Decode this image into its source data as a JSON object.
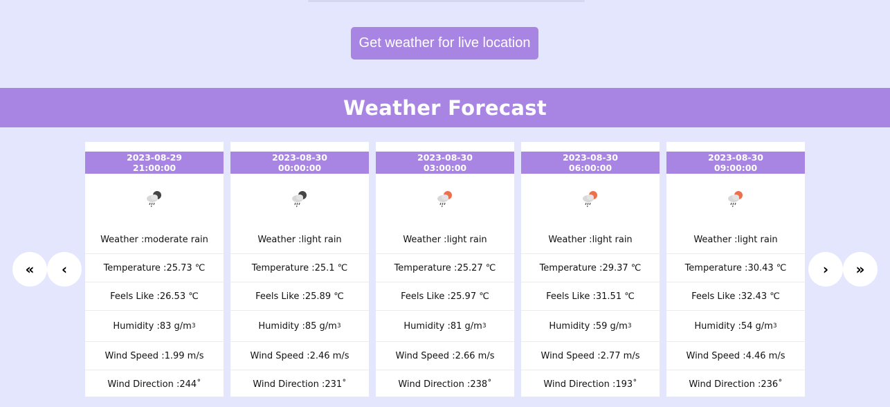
{
  "live_button": {
    "label": "Get weather for live location"
  },
  "banner": {
    "title": "Weather Forecast"
  },
  "nav": {
    "first_icon": "double-chevron-left-icon",
    "prev_icon": "chevron-left-icon",
    "next_icon": "chevron-right-icon",
    "last_icon": "double-chevron-right-icon"
  },
  "labels": {
    "weather": "Weather : ",
    "temperature": "Temperature : ",
    "feels_like": "Feels Like : ",
    "humidity": "Humidity : ",
    "wind_speed": "Wind Speed : ",
    "wind_direction": "Wind Direction : "
  },
  "forecast": [
    {
      "date": "2023-08-29",
      "time": "21:00:00",
      "icon": "rain-cloud-night-icon",
      "weather": "moderate rain",
      "temperature": "25.73 ℃",
      "feels_like": "26.53 ℃",
      "humidity": "83 g/m",
      "wind_speed": "1.99 m/s",
      "wind_direction": "244˚"
    },
    {
      "date": "2023-08-30",
      "time": "00:00:00",
      "icon": "rain-cloud-night-icon",
      "weather": "light rain",
      "temperature": "25.1 ℃",
      "feels_like": "25.89 ℃",
      "humidity": "85 g/m",
      "wind_speed": "2.46 m/s",
      "wind_direction": "231˚"
    },
    {
      "date": "2023-08-30",
      "time": "03:00:00",
      "icon": "rain-cloud-sun-icon",
      "weather": "light rain",
      "temperature": "25.27 ℃",
      "feels_like": "25.97 ℃",
      "humidity": "81 g/m",
      "wind_speed": "2.66 m/s",
      "wind_direction": "238˚"
    },
    {
      "date": "2023-08-30",
      "time": "06:00:00",
      "icon": "rain-cloud-sun-icon",
      "weather": "light rain",
      "temperature": "29.37 ℃",
      "feels_like": "31.51 ℃",
      "humidity": "59 g/m",
      "wind_speed": "2.77 m/s",
      "wind_direction": "193˚"
    },
    {
      "date": "2023-08-30",
      "time": "09:00:00",
      "icon": "rain-cloud-sun-icon",
      "weather": "light rain",
      "temperature": "30.43 ℃",
      "feels_like": "32.43 ℃",
      "humidity": "54 g/m",
      "wind_speed": "4.46 m/s",
      "wind_direction": "236˚"
    }
  ],
  "colors": {
    "accent": "#a985e3",
    "background": "#e3e6fc",
    "sun": "#ec6f4e",
    "moon": "#444444",
    "cloud": "#d8d8d8"
  }
}
